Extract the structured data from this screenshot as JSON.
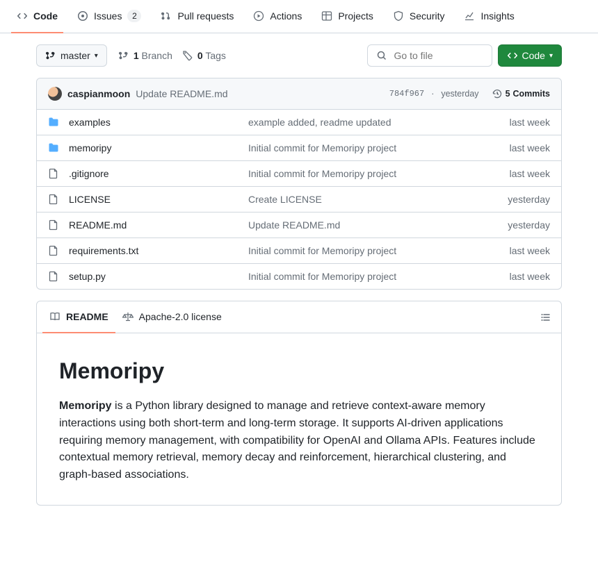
{
  "nav": {
    "items": [
      {
        "label": "Code",
        "selected": true,
        "counter": null
      },
      {
        "label": "Issues",
        "selected": false,
        "counter": "2"
      },
      {
        "label": "Pull requests",
        "selected": false,
        "counter": null
      },
      {
        "label": "Actions",
        "selected": false,
        "counter": null
      },
      {
        "label": "Projects",
        "selected": false,
        "counter": null
      },
      {
        "label": "Security",
        "selected": false,
        "counter": null
      },
      {
        "label": "Insights",
        "selected": false,
        "counter": null
      }
    ]
  },
  "toolbar": {
    "branch_label": "master",
    "branches_count": "1",
    "branches_word": "Branch",
    "tags_count": "0",
    "tags_word": "Tags",
    "search_placeholder": "Go to file",
    "code_button": "Code"
  },
  "latest_commit": {
    "author": "caspianmoon",
    "message": "Update README.md",
    "sha": "784f967",
    "when": "yesterday",
    "commits_count": "5",
    "commits_word": "Commits"
  },
  "files": [
    {
      "type": "dir",
      "name": "examples",
      "msg": "example added, readme updated",
      "when": "last week"
    },
    {
      "type": "dir",
      "name": "memoripy",
      "msg": "Initial commit for Memoripy project",
      "when": "last week"
    },
    {
      "type": "file",
      "name": ".gitignore",
      "msg": "Initial commit for Memoripy project",
      "when": "last week"
    },
    {
      "type": "file",
      "name": "LICENSE",
      "msg": "Create LICENSE",
      "when": "yesterday"
    },
    {
      "type": "file",
      "name": "README.md",
      "msg": "Update README.md",
      "when": "yesterday"
    },
    {
      "type": "file",
      "name": "requirements.txt",
      "msg": "Initial commit for Memoripy project",
      "when": "last week"
    },
    {
      "type": "file",
      "name": "setup.py",
      "msg": "Initial commit for Memoripy project",
      "when": "last week"
    }
  ],
  "readme": {
    "tabs": [
      {
        "label": "README",
        "selected": true
      },
      {
        "label": "Apache-2.0 license",
        "selected": false
      }
    ],
    "title": "Memoripy",
    "lead_strong": "Memoripy",
    "lead_rest": " is a Python library designed to manage and retrieve context-aware memory interactions using both short-term and long-term storage. It supports AI-driven applications requiring memory management, with compatibility for OpenAI and Ollama APIs. Features include contextual memory retrieval, memory decay and reinforcement, hierarchical clustering, and graph-based associations."
  }
}
